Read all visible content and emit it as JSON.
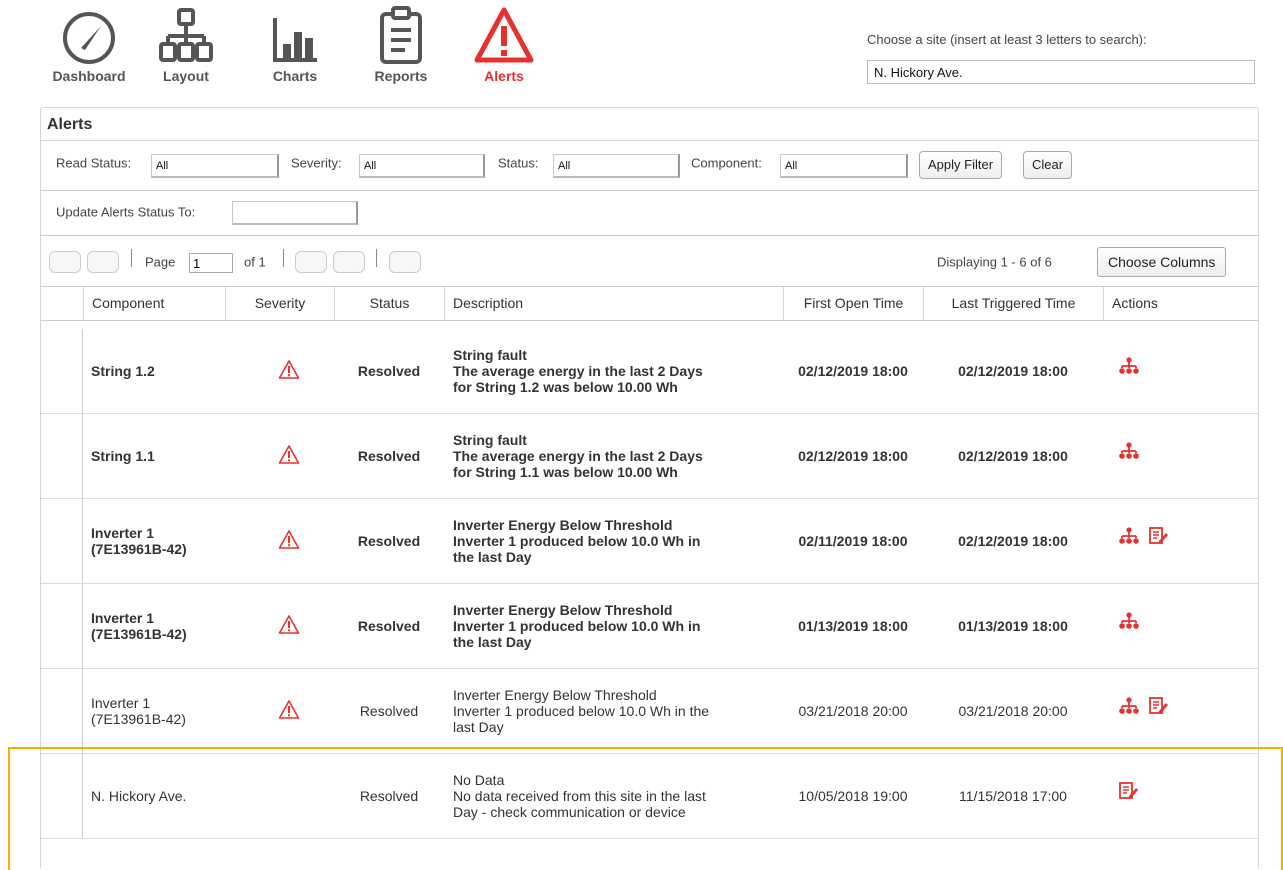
{
  "nav": {
    "items": [
      {
        "label": "Dashboard",
        "icon": "gauge-icon"
      },
      {
        "label": "Layout",
        "icon": "hierarchy-icon"
      },
      {
        "label": "Charts",
        "icon": "bar-chart-icon"
      },
      {
        "label": "Reports",
        "icon": "clipboard-icon"
      },
      {
        "label": "Alerts",
        "icon": "warning-triangle-icon"
      }
    ],
    "active": "Alerts",
    "active_color": "#e8312e"
  },
  "site_search": {
    "prompt": "Choose a site (insert at least 3 letters to search):",
    "value": "N. Hickory Ave."
  },
  "panel": {
    "title": "Alerts"
  },
  "filters": {
    "read_status_label": "Read Status:",
    "read_status_value": "All",
    "severity_label": "Severity:",
    "severity_value": "All",
    "status_label": "Status:",
    "status_value": "All",
    "component_label": "Component:",
    "component_value": "All",
    "apply_label": "Apply Filter",
    "clear_label": "Clear"
  },
  "bulk_update": {
    "label": "Update Alerts Status To:",
    "value": ""
  },
  "pager": {
    "page_label": "Page",
    "page_value": "1",
    "of_label": "of 1",
    "displaying": "Displaying 1 - 6 of 6",
    "choose_columns": "Choose Columns"
  },
  "table": {
    "columns": [
      "Component",
      "Severity",
      "Status",
      "Description",
      "First Open Time",
      "Last Triggered Time",
      "Actions"
    ],
    "rows": [
      {
        "component": [
          "String 1.2"
        ],
        "severity_icon": "warning-triangle-icon",
        "status": "Resolved",
        "description": [
          "String fault",
          "The average energy in the last 2 Days",
          "for String 1.2 was below 10.00 Wh"
        ],
        "first_open": "02/12/2019 18:00",
        "last_triggered": "02/12/2019 18:00",
        "unread": true,
        "actions": [
          "hierarchy-icon"
        ]
      },
      {
        "component": [
          "String 1.1"
        ],
        "severity_icon": "warning-triangle-icon",
        "status": "Resolved",
        "description": [
          "String fault",
          "The average energy in the last 2 Days",
          "for String 1.1 was below 10.00 Wh"
        ],
        "first_open": "02/12/2019 18:00",
        "last_triggered": "02/12/2019 18:00",
        "unread": true,
        "actions": [
          "hierarchy-icon"
        ]
      },
      {
        "component": [
          "Inverter 1",
          "(7E13961B-42)"
        ],
        "severity_icon": "warning-triangle-icon",
        "status": "Resolved",
        "description": [
          "Inverter Energy Below Threshold",
          "Inverter 1 produced below 10.0 Wh in",
          "the last Day"
        ],
        "first_open": "02/11/2019 18:00",
        "last_triggered": "02/12/2019 18:00",
        "unread": true,
        "actions": [
          "hierarchy-icon",
          "note-edit-icon"
        ]
      },
      {
        "component": [
          "Inverter 1",
          "(7E13961B-42)"
        ],
        "severity_icon": "warning-triangle-icon",
        "status": "Resolved",
        "description": [
          "Inverter Energy Below Threshold",
          "Inverter 1 produced below 10.0 Wh in",
          "the last Day"
        ],
        "first_open": "01/13/2019 18:00",
        "last_triggered": "01/13/2019 18:00",
        "unread": true,
        "actions": [
          "hierarchy-icon"
        ]
      },
      {
        "component": [
          "Inverter 1",
          "(7E13961B-42)"
        ],
        "severity_icon": "warning-triangle-icon",
        "status": "Resolved",
        "description": [
          "Inverter Energy Below Threshold",
          "Inverter 1 produced below 10.0 Wh in the",
          "last Day"
        ],
        "first_open": "03/21/2018 20:00",
        "last_triggered": "03/21/2018 20:00",
        "unread": false,
        "actions": [
          "hierarchy-icon",
          "note-edit-icon"
        ]
      },
      {
        "component": [
          "N. Hickory Ave."
        ],
        "severity_icon": "",
        "status": "Resolved",
        "description": [
          "No Data",
          "No data received from this site in the last",
          "Day - check communication or device"
        ],
        "first_open": "10/05/2018 19:00",
        "last_triggered": "11/15/2018 17:00",
        "unread": false,
        "actions": [
          "note-edit-icon"
        ]
      }
    ]
  },
  "colors": {
    "alert_red": "#e8312e",
    "highlight": "#f0b400"
  }
}
